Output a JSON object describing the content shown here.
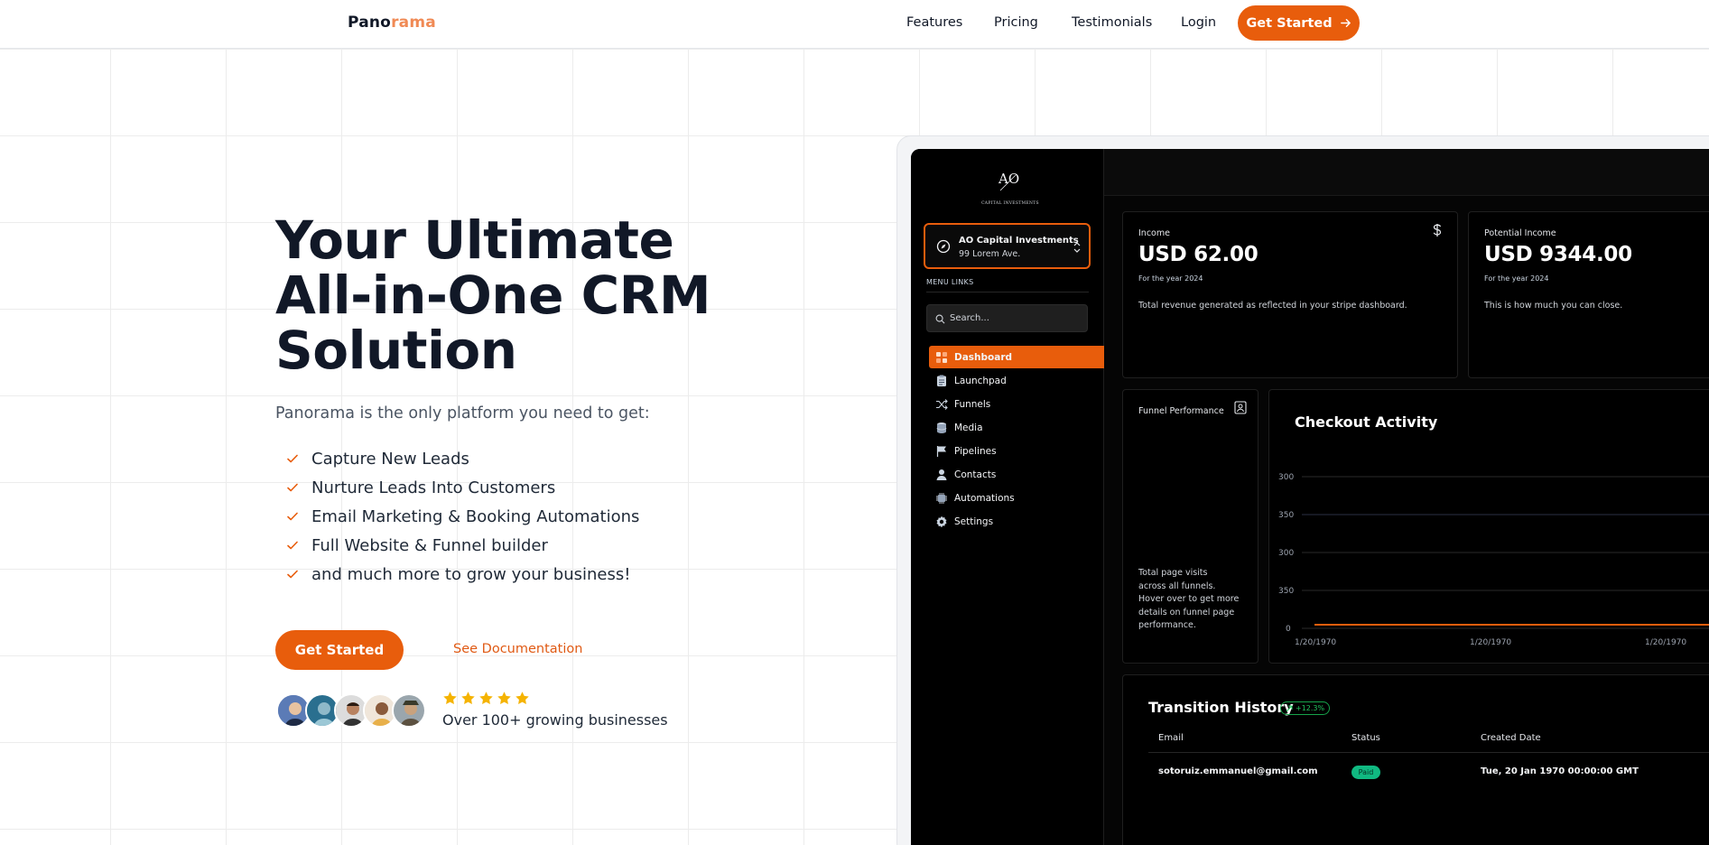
{
  "brand": {
    "name_main": "Pano",
    "name_accent": "rama",
    "accent_color": "#f08a55"
  },
  "nav": {
    "links": [
      "Features",
      "Pricing",
      "Testimonials",
      "Login"
    ],
    "cta_label": "Get Started",
    "cta_icon": "arrow-right-icon"
  },
  "hero": {
    "title": "Your Ultimate All-in-One CRM Solution",
    "subtitle": "Panorama is the only platform you need to get:",
    "features": [
      "Capture New Leads",
      "Nurture Leads Into Customers",
      "Email Marketing & Booking Automations",
      "Full Website & Funnel builder",
      "and much more to grow your business!"
    ],
    "primary_button": "Get Started",
    "secondary_link": "See Documentation",
    "rating_stars": 5,
    "social_proof": "Over 100+ growing businesses",
    "accent_color": "#e85d0c"
  },
  "dashboard": {
    "brand_mark": "AO",
    "brand_sub": "CAPITAL INVESTMENTS",
    "account": {
      "name": "AO Capital Investments",
      "address": "99 Lorem Ave."
    },
    "menu_label": "MENU LINKS",
    "search_placeholder": "Search...",
    "menu": [
      {
        "label": "Dashboard",
        "icon": "dashboard-icon",
        "active": true
      },
      {
        "label": "Launchpad",
        "icon": "clipboard-icon",
        "active": false
      },
      {
        "label": "Funnels",
        "icon": "shuffle-icon",
        "active": false
      },
      {
        "label": "Media",
        "icon": "database-icon",
        "active": false
      },
      {
        "label": "Pipelines",
        "icon": "flag-icon",
        "active": false
      },
      {
        "label": "Contacts",
        "icon": "user-icon",
        "active": false
      },
      {
        "label": "Automations",
        "icon": "chip-icon",
        "active": false
      },
      {
        "label": "Settings",
        "icon": "gear-icon",
        "active": false
      }
    ],
    "income": {
      "label": "Income",
      "value": "USD 62.00",
      "period": "For the year 2024",
      "description": "Total revenue generated as reflected in your stripe dashboard.",
      "icon": "dollar-icon"
    },
    "potential_income": {
      "label": "Potential Income",
      "value": "USD 9344.00",
      "period": "For the year 2024",
      "description": "This is how much you can close."
    },
    "funnel": {
      "label": "Funnel Performance",
      "icon": "contact-card-icon",
      "description_lines": [
        "Total page visits",
        "across all funnels.",
        "Hover over to get more",
        "details on funnel page",
        "performance."
      ]
    },
    "checkout": {
      "title": "Checkout Activity",
      "y_ticks": [
        "300",
        "350",
        "300",
        "350",
        "0"
      ],
      "x_ticks": [
        "1/20/1970",
        "1/20/1970",
        "1/20/1970"
      ],
      "line_color": "#e85d0c"
    },
    "transitions": {
      "title": "Transition History",
      "badge": "+12.3%",
      "columns": [
        "Email",
        "Status",
        "Created Date"
      ],
      "rows": [
        {
          "email": "sotoruiz.emmanuel@gmail.com",
          "status": "Paid",
          "date": "Tue, 20 Jan 1970 00:00:00 GMT"
        }
      ]
    }
  }
}
